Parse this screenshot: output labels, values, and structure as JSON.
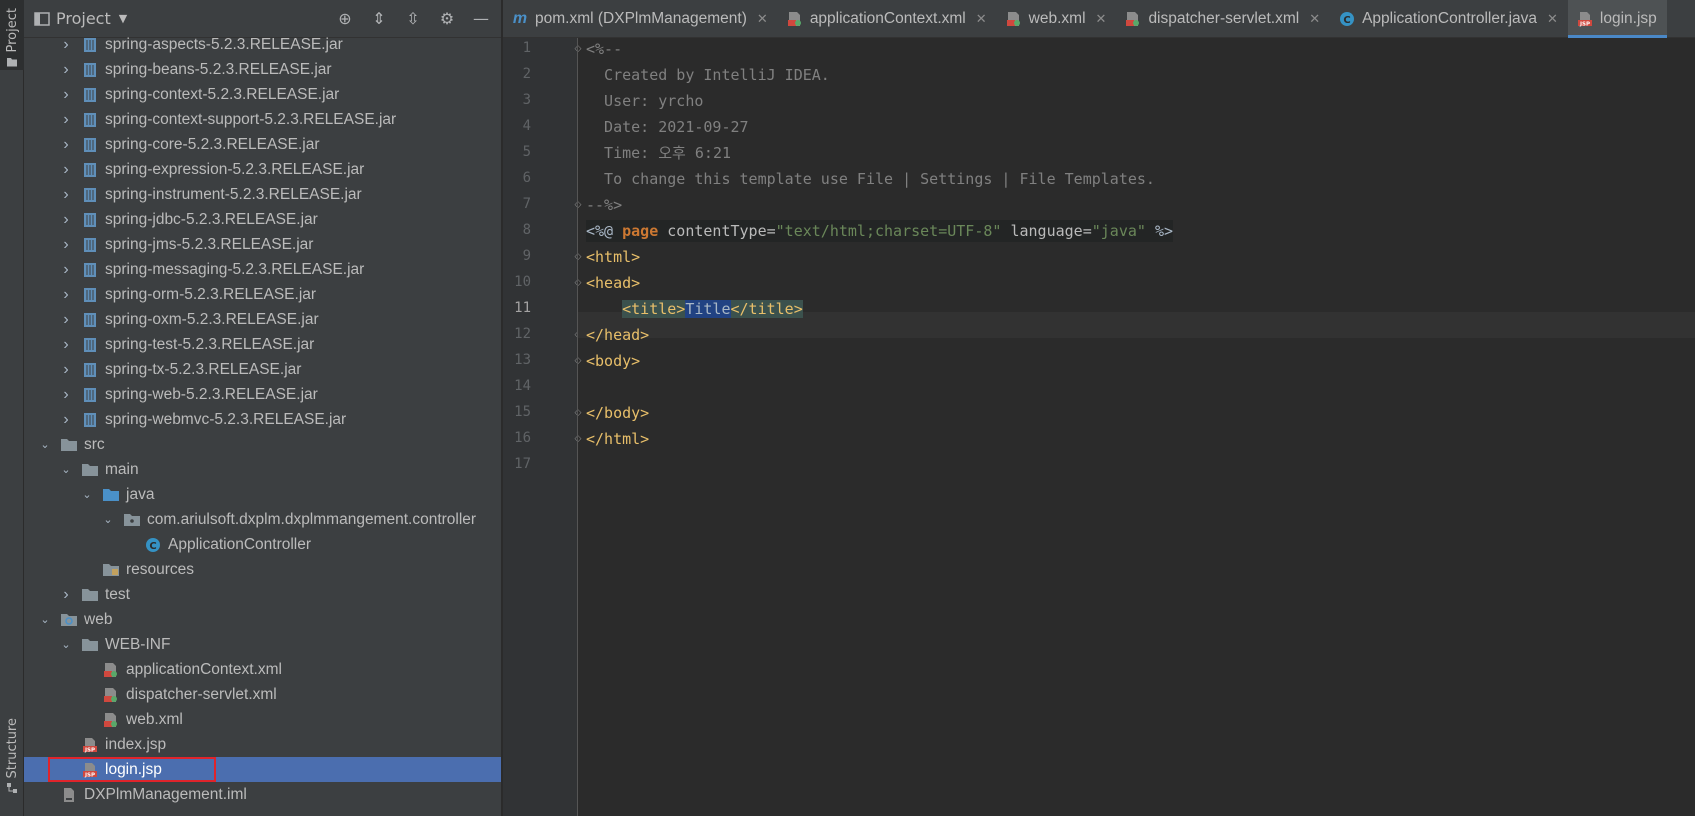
{
  "stripe": {
    "project_label": "Project",
    "structure_label": "Structure"
  },
  "project_panel": {
    "title": "Project",
    "tree": [
      {
        "label": "spring-aspects-5.2.3.RELEASE.jar",
        "type": "jar",
        "indent": 1
      },
      {
        "label": "spring-beans-5.2.3.RELEASE.jar",
        "type": "jar",
        "indent": 1
      },
      {
        "label": "spring-context-5.2.3.RELEASE.jar",
        "type": "jar",
        "indent": 1
      },
      {
        "label": "spring-context-support-5.2.3.RELEASE.jar",
        "type": "jar",
        "indent": 1
      },
      {
        "label": "spring-core-5.2.3.RELEASE.jar",
        "type": "jar",
        "indent": 1
      },
      {
        "label": "spring-expression-5.2.3.RELEASE.jar",
        "type": "jar",
        "indent": 1
      },
      {
        "label": "spring-instrument-5.2.3.RELEASE.jar",
        "type": "jar",
        "indent": 1
      },
      {
        "label": "spring-jdbc-5.2.3.RELEASE.jar",
        "type": "jar",
        "indent": 1
      },
      {
        "label": "spring-jms-5.2.3.RELEASE.jar",
        "type": "jar",
        "indent": 1
      },
      {
        "label": "spring-messaging-5.2.3.RELEASE.jar",
        "type": "jar",
        "indent": 1
      },
      {
        "label": "spring-orm-5.2.3.RELEASE.jar",
        "type": "jar",
        "indent": 1
      },
      {
        "label": "spring-oxm-5.2.3.RELEASE.jar",
        "type": "jar",
        "indent": 1
      },
      {
        "label": "spring-test-5.2.3.RELEASE.jar",
        "type": "jar",
        "indent": 1
      },
      {
        "label": "spring-tx-5.2.3.RELEASE.jar",
        "type": "jar",
        "indent": 1
      },
      {
        "label": "spring-web-5.2.3.RELEASE.jar",
        "type": "jar",
        "indent": 1
      },
      {
        "label": "spring-webmvc-5.2.3.RELEASE.jar",
        "type": "jar",
        "indent": 1
      },
      {
        "label": "src",
        "type": "folder",
        "indent": 0,
        "expanded": true
      },
      {
        "label": "main",
        "type": "folder",
        "indent": 1,
        "expanded": true
      },
      {
        "label": "java",
        "type": "source-folder",
        "indent": 2,
        "expanded": true
      },
      {
        "label": "com.ariulsoft.dxplm.dxplmmangement.controller",
        "type": "package",
        "indent": 3,
        "expanded": true
      },
      {
        "label": "ApplicationController",
        "type": "class",
        "indent": 4
      },
      {
        "label": "resources",
        "type": "resources-folder",
        "indent": 2
      },
      {
        "label": "test",
        "type": "folder",
        "indent": 1,
        "expanded": false
      },
      {
        "label": "web",
        "type": "web-folder",
        "indent": 0,
        "expanded": true
      },
      {
        "label": "WEB-INF",
        "type": "folder",
        "indent": 1,
        "expanded": true
      },
      {
        "label": "applicationContext.xml",
        "type": "xml",
        "indent": 2
      },
      {
        "label": "dispatcher-servlet.xml",
        "type": "xml",
        "indent": 2
      },
      {
        "label": "web.xml",
        "type": "xml",
        "indent": 2
      },
      {
        "label": "index.jsp",
        "type": "jsp",
        "indent": 1
      },
      {
        "label": "login.jsp",
        "type": "jsp",
        "indent": 1,
        "selected": true
      },
      {
        "label": "DXPlmManagement.iml",
        "type": "iml",
        "indent": 0
      }
    ]
  },
  "tabs": [
    {
      "label": "pom.xml (DXPlmManagement)",
      "icon": "maven-icon"
    },
    {
      "label": "applicationContext.xml",
      "icon": "xml-icon"
    },
    {
      "label": "web.xml",
      "icon": "xml-icon"
    },
    {
      "label": "dispatcher-servlet.xml",
      "icon": "xml-icon"
    },
    {
      "label": "ApplicationController.java",
      "icon": "class-icon"
    },
    {
      "label": "login.jsp",
      "icon": "jsp-icon",
      "active": true
    }
  ],
  "editor": {
    "current_line": 11,
    "line_numbers": [
      "1",
      "2",
      "3",
      "4",
      "5",
      "6",
      "7",
      "8",
      "9",
      "10",
      "11",
      "12",
      "13",
      "14",
      "15",
      "16",
      "17"
    ],
    "lines": {
      "l1": "<%--",
      "l2": "  Created by IntelliJ IDEA.",
      "l3": "  User: yrcho",
      "l4": "  Date: 2021-09-27",
      "l5": "  Time: 오후 6:21",
      "l6": "  To change this template use File | Settings | File Templates.",
      "l7": "--%>",
      "l8": {
        "open": "<%@ ",
        "kw": "page",
        "attr1": " contentType=",
        "val1": "\"text/html;charset=UTF-8\"",
        "attr2": " language=",
        "val2": "\"java\"",
        "close": " %>"
      },
      "l9": "<html>",
      "l10": "<head>",
      "l11": {
        "indent": "    ",
        "open": "<title>",
        "text": "Title",
        "close": "</title>"
      },
      "l12": "</head>",
      "l13": "<body>",
      "l14": "",
      "l15": "</body>",
      "l16": "</html>",
      "l17": ""
    }
  }
}
